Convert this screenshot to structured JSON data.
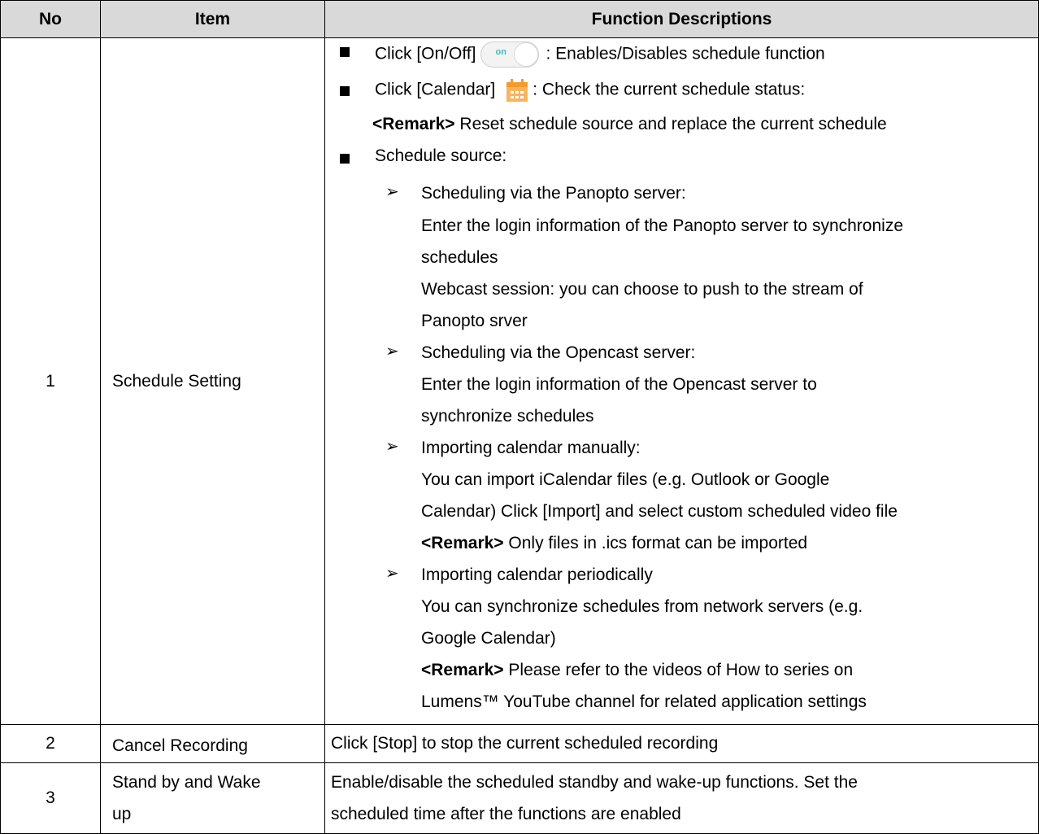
{
  "headers": {
    "no": "No",
    "item": "Item",
    "desc": "Function Descriptions"
  },
  "row1": {
    "no": "1",
    "item": "Schedule Setting",
    "onoff_prefix": "Click [On/Off]",
    "toggle_label": "on",
    "onoff_suffix": ": Enables/Disables schedule function",
    "calendar_prefix": "Click [Calendar]",
    "calendar_suffix": ": Check the current schedule status:",
    "remark_tag": "<Remark>",
    "remark1": " Reset schedule source and replace the current schedule",
    "source_label": "Schedule source:",
    "arrow_glyph": "➢",
    "panopto_title": "Scheduling via the Panopto server:",
    "panopto_l1": "Enter the login information of the Panopto server to synchronize",
    "panopto_l2": "schedules",
    "panopto_l3": "Webcast session: you can choose to push to the stream of",
    "panopto_l4": "Panopto srver",
    "opencast_title": "Scheduling via the Opencast server:",
    "opencast_l1": "Enter the login information of the Opencast server to",
    "opencast_l2": "synchronize schedules",
    "manual_title": "Importing calendar manually:",
    "manual_l1": "You can import iCalendar files (e.g. Outlook or Google",
    "manual_l2": "Calendar) Click [Import] and select custom scheduled video file",
    "manual_remark": " Only files in .ics format can be imported",
    "periodic_title": "Importing calendar periodically",
    "periodic_l1": "You can synchronize schedules from network servers (e.g.",
    "periodic_l2": "Google Calendar)",
    "periodic_remark": " Please refer to the videos of How to series on",
    "periodic_l3": "Lumens™ YouTube channel for related application settings"
  },
  "row2": {
    "no": "2",
    "item": "Cancel Recording",
    "desc": "Click [Stop] to stop the current scheduled recording"
  },
  "row3": {
    "no": "3",
    "item_l1": "Stand by and Wake",
    "item_l2": "up",
    "desc_l1": "Enable/disable the scheduled standby and wake-up functions. Set the",
    "desc_l2": "scheduled time after the functions are enabled"
  },
  "colors": {
    "header_bg": "#d9d9d9",
    "toggle_text": "#3fc1b8",
    "calendar_icon": "#f39c2b"
  }
}
